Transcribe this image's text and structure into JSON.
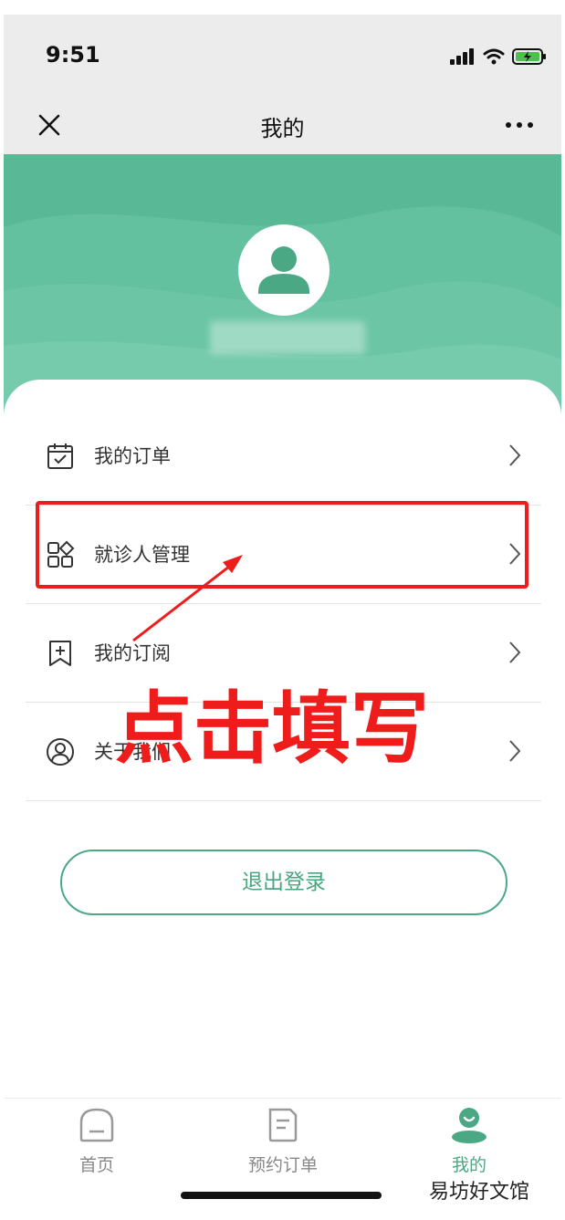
{
  "status_bar": {
    "time": "9:51"
  },
  "nav": {
    "title": "我的"
  },
  "menu": [
    {
      "label": "我的订单",
      "icon": "calendar-check-icon"
    },
    {
      "label": "就诊人管理",
      "icon": "grid-apps-icon"
    },
    {
      "label": "我的订阅",
      "icon": "bookmark-add-icon"
    },
    {
      "label": "关于我们",
      "icon": "user-circle-icon"
    }
  ],
  "logout": {
    "label": "退出登录"
  },
  "annotation": {
    "text": "点击填写"
  },
  "tabs": [
    {
      "label": "首页",
      "icon": "home-icon",
      "active": false
    },
    {
      "label": "预约订单",
      "icon": "document-icon",
      "active": false
    },
    {
      "label": "我的",
      "icon": "profile-icon",
      "active": true
    }
  ],
  "watermark": "易坊好文馆",
  "colors": {
    "brand_green": "#59b996",
    "active_tab": "#4aa984",
    "annotation_red": "#ef1c1c"
  }
}
